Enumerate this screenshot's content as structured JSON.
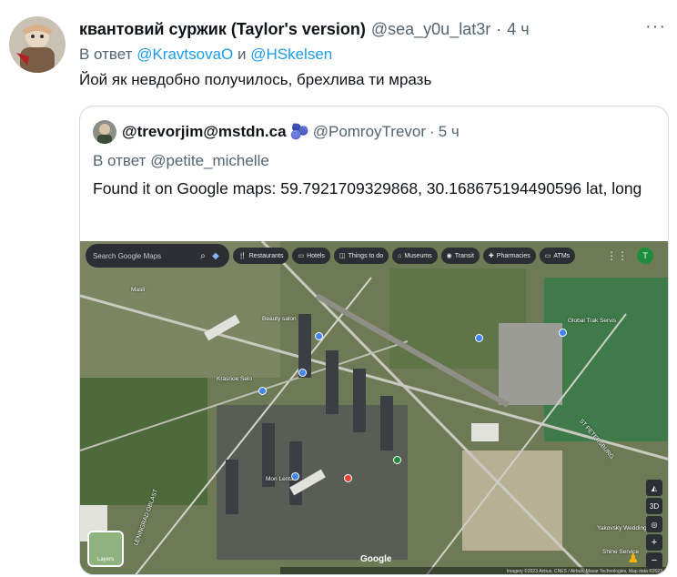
{
  "tweet": {
    "author_name": "квантовий суржик (Taylor's version)",
    "author_handle": "@sea_y0u_lat3r",
    "time_sep": "·",
    "time": "4 ч",
    "more_icon": "more-icon",
    "reply_prefix": "В ответ",
    "reply_user_1": "@KravtsovaO",
    "reply_and": "и",
    "reply_user_2": "@HSkelsen",
    "text": "Йой як невдобно получилось, брехлива ти мразь"
  },
  "quote": {
    "author_name": "@trevorjim@mstdn.ca",
    "author_emoji": "🫐",
    "author_handle": "@PomroyTrevor",
    "time_sep": "·",
    "time": "5 ч",
    "reply_prefix": "В ответ",
    "reply_user": "@petite_michelle",
    "text": "Found it on Google maps: 59.7921709329868, 30.168675194490596 lat, long"
  },
  "map": {
    "search_placeholder": "Search Google Maps",
    "chips": [
      {
        "icon": "restaurant-icon",
        "glyph": "🍴",
        "label": "Restaurants"
      },
      {
        "icon": "hotel-icon",
        "glyph": "▭",
        "label": "Hotels"
      },
      {
        "icon": "things-icon",
        "glyph": "◫",
        "label": "Things to do"
      },
      {
        "icon": "museum-icon",
        "glyph": "⌂",
        "label": "Museums"
      },
      {
        "icon": "transit-icon",
        "glyph": "◉",
        "label": "Transit"
      },
      {
        "icon": "pharmacy-icon",
        "glyph": "✚",
        "label": "Pharmacies"
      },
      {
        "icon": "atm-icon",
        "glyph": "▭",
        "label": "ATMs"
      }
    ],
    "user_initial": "T",
    "layers_label": "Layers",
    "google_label": "Google",
    "attribution": "Imagery ©2023 Airbus, CNES / Airbus, Maxar Technologies, Map data ©2023",
    "control_3d": "3D",
    "place_labels": [
      {
        "text": "Global Trak Servis",
        "name": "place-label-global-trak"
      },
      {
        "text": "Mon Lenta",
        "name": "place-label-lenta"
      },
      {
        "text": "ST PETERSBURG",
        "name": "place-label-st-petersburg"
      },
      {
        "text": "LENINGRAD OBLAST",
        "name": "place-label-leningrad-oblast"
      },
      {
        "text": "Yakovsky Wedding",
        "name": "place-label-yakovsky"
      },
      {
        "text": "Shine Service",
        "name": "place-label-shine"
      },
      {
        "text": "Beauty salon",
        "name": "place-label-beauty"
      },
      {
        "text": "Krasnoe Selo",
        "name": "place-label-krasnoe"
      },
      {
        "text": "Masli",
        "name": "place-label-masli"
      }
    ]
  },
  "colors": {
    "text_primary": "#0f1419",
    "text_secondary": "#536471",
    "link": "#1d9bf0",
    "border": "#cfd9de"
  }
}
